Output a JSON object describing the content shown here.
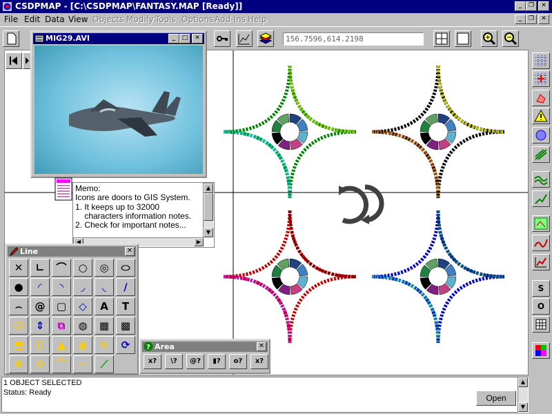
{
  "window": {
    "title": "CSDPMAP - [C:\\CSDPMAP\\FANTASY.MAP [Ready]]",
    "controls": [
      "_",
      "❐",
      "✕"
    ]
  },
  "menu": [
    "File",
    "Edit",
    "Data",
    "View",
    "Objects",
    "Modify",
    "Tools",
    "Options",
    "Add-Ins",
    "Help"
  ],
  "toolbar": {
    "coordinates": "156.7596,614.2198"
  },
  "avi_window": {
    "title": "MIG29.AVI"
  },
  "memo": {
    "text": "Memo:\nIcons are doors to GIS System.\n1. It keeps up to 32000\n    characters information notes.\n2. Check for important notes..."
  },
  "line_palette": {
    "title": "Line",
    "tools": [
      "select-line",
      "line",
      "polyline",
      "circle",
      "circle-zoom",
      "ellipse",
      "ring",
      "arc",
      "sector",
      "chord",
      "pie",
      "curve",
      "arc2",
      "spiral",
      "rounded-rect",
      "diamond",
      "text",
      "text-style",
      "smiley",
      "stack",
      "chain",
      "sphere",
      "grid",
      "hatch",
      "cube",
      "cylinder",
      "cone",
      "sphere-solid",
      "asterisk",
      "gear-arrow",
      "globe",
      "puzzle",
      "arch",
      "parallelogram",
      "cut"
    ]
  },
  "area_palette": {
    "title": "Area",
    "tools": [
      "x?",
      "\\?",
      "@?",
      "▮?",
      "o?",
      "x?"
    ]
  },
  "right_toolbar": {
    "buttons": [
      "S",
      "O"
    ]
  },
  "status": {
    "line1": "1 OBJECT SELECTED",
    "line2": "Status: Ready",
    "open_button": "Open"
  },
  "colors": {
    "titlebar": "#000080",
    "background": "#c0c0c0",
    "map": "#ffffff"
  }
}
